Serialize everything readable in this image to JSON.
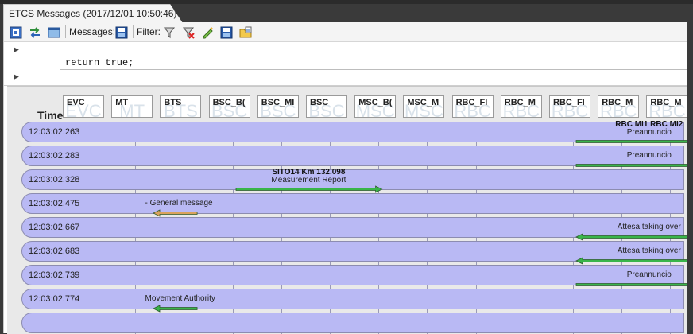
{
  "window": {
    "title": "ETCS Messages (2017/12/01 10:50:46)"
  },
  "toolbar": {
    "messages_label": "Messages:",
    "filter_label": "Filter:",
    "buttons": [
      {
        "name": "view-icon",
        "group": "left"
      },
      {
        "name": "swap-icon",
        "group": "left"
      },
      {
        "name": "window-icon",
        "group": "left"
      },
      {
        "name": "save-messages-icon",
        "group": "messages"
      },
      {
        "name": "filter-icon",
        "group": "filter"
      },
      {
        "name": "filter-remove-icon",
        "group": "filter"
      },
      {
        "name": "filter-edit-icon",
        "group": "filter"
      },
      {
        "name": "filter-save-icon",
        "group": "filter"
      },
      {
        "name": "filter-open-icon",
        "group": "filter"
      }
    ]
  },
  "editor": {
    "code": "return true;"
  },
  "grid": {
    "time_header": "Time",
    "columns": [
      {
        "label": "EVC",
        "wm": "EVC"
      },
      {
        "label": "MT",
        "wm": "MT"
      },
      {
        "label": "BTS",
        "wm": "BTS"
      },
      {
        "label": "BSC_B(",
        "wm": "BSC"
      },
      {
        "label": "BSC_MI",
        "wm": "BSC"
      },
      {
        "label": "BSC",
        "wm": "BSC"
      },
      {
        "label": "MSC_B(",
        "wm": "MSC"
      },
      {
        "label": "MSC_M",
        "wm": "MSC"
      },
      {
        "label": "RBC_FI",
        "wm": "RBC"
      },
      {
        "label": "RBC_M",
        "wm": "RBC"
      },
      {
        "label": "RBC_FI",
        "wm": "RBC"
      },
      {
        "label": "RBC_M",
        "wm": "RBC"
      },
      {
        "label": "RBC_M",
        "wm": "RBC"
      }
    ],
    "rows": [
      {
        "time": "12:03:02.263",
        "title": "RBC MI1 RBC MI2",
        "label": "Preannuncio",
        "from": 10,
        "to": 13,
        "color": "#39b54a"
      },
      {
        "time": "12:03:02.283",
        "title": "",
        "label": "Preannuncio",
        "from": 10,
        "to": 13,
        "color": "#39b54a"
      },
      {
        "time": "12:03:02.328",
        "title": "SITO14 Km 132.098",
        "label": "Measurement Report",
        "from": 3,
        "to": 6,
        "color": "#39b54a"
      },
      {
        "time": "12:03:02.475",
        "title": "",
        "label": "- General message",
        "from": 2.2,
        "to": 1.3,
        "color": "#d9a25b"
      },
      {
        "time": "12:03:02.667",
        "title": "",
        "label": "Attesa taking over",
        "from": 13,
        "to": 10,
        "color": "#39b54a"
      },
      {
        "time": "12:03:02.683",
        "title": "",
        "label": "Attesa taking over",
        "from": 13,
        "to": 10,
        "color": "#39b54a"
      },
      {
        "time": "12:03:02.739",
        "title": "",
        "label": "Preannuncio",
        "from": 10,
        "to": 13,
        "color": "#39b54a"
      },
      {
        "time": "12:03:02.774",
        "title": "",
        "label": "Movement Authority",
        "from": 2.2,
        "to": 1.3,
        "color": "#39b54a"
      },
      {
        "time": "",
        "title": "",
        "label": "",
        "from": 0,
        "to": 0,
        "color": "#39b54a"
      }
    ]
  },
  "colors": {
    "row_fill": "#b9b9f4",
    "arrow_green": "#39b54a",
    "arrow_orange": "#d9a25b"
  }
}
